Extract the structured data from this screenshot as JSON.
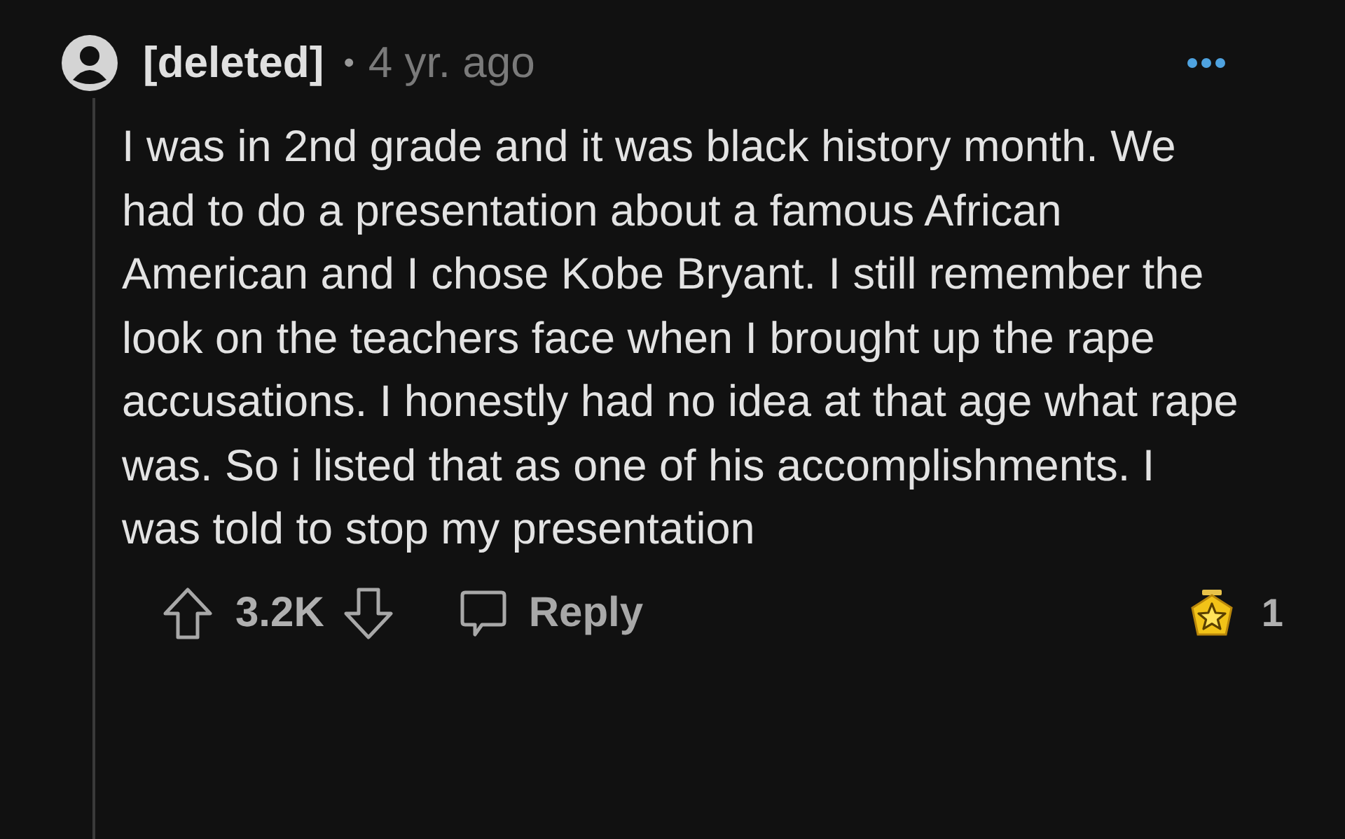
{
  "comment": {
    "author": "[deleted]",
    "separator": "•",
    "time": "4 yr. ago",
    "body": "I was in 2nd grade and it was black history month. We had to do a presentation about a famous African American and I chose Kobe Bryant. I still remember the look on the teachers face when I brought up the rape accusations. I honestly had no idea at that age what rape was. So i listed that as one of his accomplishments. I was told to stop my presentation",
    "score": "3.2K",
    "reply_label": "Reply",
    "award_count": "1"
  }
}
